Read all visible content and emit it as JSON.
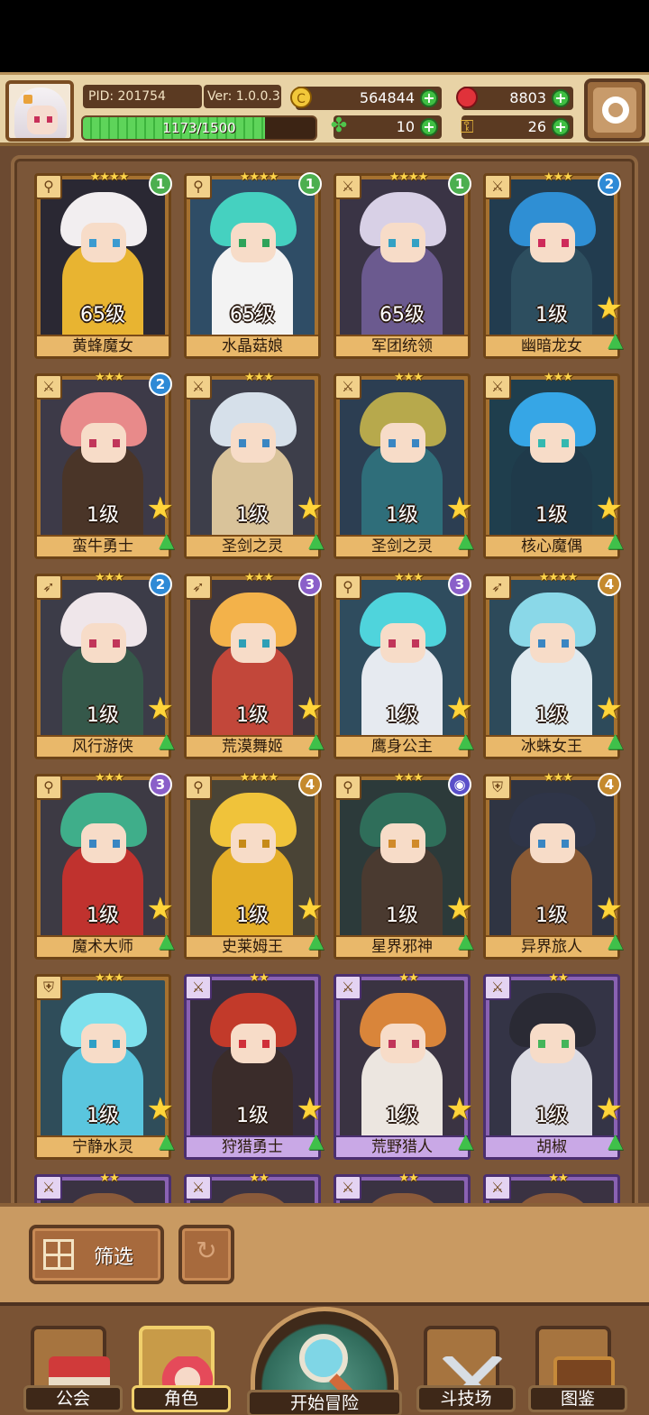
{
  "header": {
    "pid": "PID: 201754",
    "version": "Ver: 1.0.0.3",
    "exp": {
      "text": "1173/1500",
      "current": 1173,
      "max": 1500
    },
    "resources": [
      {
        "name": "gold",
        "icon": "coin-icon",
        "value": "564844",
        "color": "#f2c83a"
      },
      {
        "name": "gems",
        "icon": "red-gem-icon",
        "value": "8803",
        "color": "#e0323a"
      },
      {
        "name": "clover",
        "icon": "clover-icon",
        "value": "10",
        "color": "#4fc54c"
      },
      {
        "name": "key",
        "icon": "key-icon",
        "value": "26",
        "color": "#e4b43a"
      }
    ]
  },
  "cards": [
    {
      "name": "黄蜂魔女",
      "level": "65级",
      "stars": "★★★★",
      "rank": "1",
      "rankColor": "#4caf50",
      "frame": "gold",
      "class": "wand",
      "hair": "#f2eef0",
      "outfit": "#e8b431",
      "bg": "#2a2833",
      "eye": "#3c9bd0",
      "upgrade": false
    },
    {
      "name": "水晶菇娘",
      "level": "65级",
      "stars": "★★★★",
      "rank": "1",
      "rankColor": "#4caf50",
      "frame": "gold",
      "class": "wand",
      "hair": "#45d1c0",
      "outfit": "#f3f3f3",
      "bg": "#2f4d66",
      "eye": "#2fa35a",
      "upgrade": false
    },
    {
      "name": "军团统领",
      "level": "65级",
      "stars": "★★★★",
      "rank": "1",
      "rankColor": "#4caf50",
      "frame": "gold",
      "class": "sword",
      "hair": "#d8d0e6",
      "outfit": "#6b5a8f",
      "bg": "#3a3445",
      "eye": "#34a1c4",
      "upgrade": false
    },
    {
      "name": "幽暗龙女",
      "level": "1级",
      "stars": "★★★",
      "rank": "2",
      "rankColor": "#2e8ad6",
      "frame": "gold",
      "class": "sword",
      "hair": "#2f8fd4",
      "outfit": "#2d4e5f",
      "bg": "#223c4f",
      "eye": "#ce2b5a",
      "upgrade": true
    },
    {
      "name": "蛮牛勇士",
      "level": "1级",
      "stars": "★★★",
      "rank": "2",
      "rankColor": "#2e8ad6",
      "frame": "gold",
      "class": "sword",
      "hair": "#e88a8a",
      "outfit": "#4a3528",
      "bg": "#3d3a48",
      "eye": "#c1365a",
      "upgrade": true
    },
    {
      "name": "圣剑之灵",
      "level": "1级",
      "stars": "★★★",
      "rank": "",
      "rankColor": "",
      "frame": "gold",
      "class": "sword",
      "hair": "#d6e0ea",
      "outfit": "#d9c39a",
      "bg": "#3d3e4a",
      "eye": "#3a86c2",
      "upgrade": true
    },
    {
      "name": "圣剑之灵",
      "level": "1级",
      "stars": "★★★",
      "rank": "",
      "rankColor": "",
      "frame": "gold",
      "class": "sword",
      "hair": "#b7a94c",
      "outfit": "#2f6e7a",
      "bg": "#2c3e52",
      "eye": "#3a86c2",
      "upgrade": true
    },
    {
      "name": "核心魔偶",
      "level": "1级",
      "stars": "★★★",
      "rank": "",
      "rankColor": "",
      "frame": "gold",
      "class": "sword",
      "hair": "#36a6e6",
      "outfit": "#1f3a4a",
      "bg": "#1f3e4d",
      "eye": "#35b8b0",
      "upgrade": true
    },
    {
      "name": "风行游侠",
      "level": "1级",
      "stars": "★★★",
      "rank": "2",
      "rankColor": "#2e8ad6",
      "frame": "gold",
      "class": "bow",
      "hair": "#efe6ea",
      "outfit": "#35584a",
      "bg": "#3c3c48",
      "eye": "#c1365a",
      "upgrade": true
    },
    {
      "name": "荒漠舞姬",
      "level": "1级",
      "stars": "★★★",
      "rank": "3",
      "rankColor": "#8a5fc9",
      "frame": "gold",
      "class": "bow",
      "hair": "#f3b24a",
      "outfit": "#c2473a",
      "bg": "#40383e",
      "eye": "#2f9fb6",
      "upgrade": true
    },
    {
      "name": "鹰身公主",
      "level": "1级",
      "stars": "★★★",
      "rank": "3",
      "rankColor": "#8a5fc9",
      "frame": "gold",
      "class": "wand",
      "hair": "#4fd4dc",
      "outfit": "#e6eaf0",
      "bg": "#2f4c5e",
      "eye": "#c1365a",
      "upgrade": true
    },
    {
      "name": "冰蛛女王",
      "level": "1级",
      "stars": "★★★★",
      "rank": "4",
      "rankColor": "#c58a2e",
      "frame": "gold",
      "class": "bow",
      "hair": "#8ad8e8",
      "outfit": "#dfeaf0",
      "bg": "#2d4a5a",
      "eye": "#3a86c2",
      "upgrade": true
    },
    {
      "name": "魔术大师",
      "level": "1级",
      "stars": "★★★",
      "rank": "3",
      "rankColor": "#8a5fc9",
      "frame": "gold",
      "class": "wand",
      "hair": "#3fae8a",
      "outfit": "#c0322e",
      "bg": "#3d3a44",
      "eye": "#3a86c2",
      "upgrade": true
    },
    {
      "name": "史莱姆王",
      "level": "1级",
      "stars": "★★★★",
      "rank": "4",
      "rankColor": "#c58a2e",
      "frame": "gold",
      "class": "wand",
      "hair": "#f0c33a",
      "outfit": "#e4ae28",
      "bg": "#4a4436",
      "eye": "#c68a18",
      "upgrade": true
    },
    {
      "name": "星界邪神",
      "level": "1级",
      "stars": "★★★",
      "rank": "◉",
      "rankColor": "#5a4fc9",
      "frame": "gold",
      "class": "wand",
      "hair": "#2f6e5a",
      "outfit": "#4a3a30",
      "bg": "#2c3a3a",
      "eye": "#d08a2a",
      "upgrade": true
    },
    {
      "name": "异界旅人",
      "level": "1级",
      "stars": "★★★",
      "rank": "4",
      "rankColor": "#c58a2e",
      "frame": "gold",
      "class": "shield",
      "hair": "#2f3548",
      "outfit": "#8a5a34",
      "bg": "#2f3442",
      "eye": "#3a86c2",
      "upgrade": true
    },
    {
      "name": "宁静水灵",
      "level": "1级",
      "stars": "★★★",
      "rank": "",
      "rankColor": "",
      "frame": "gold",
      "class": "shield",
      "hair": "#7ee0ec",
      "outfit": "#5ac6de",
      "bg": "#2f4d5a",
      "eye": "#2f9fc6",
      "upgrade": true
    },
    {
      "name": "狩猎勇士",
      "level": "1级",
      "stars": "★★",
      "rank": "",
      "rankColor": "",
      "frame": "purple",
      "class": "sword",
      "hair": "#c23a2a",
      "outfit": "#3a2c2a",
      "bg": "#362e3e",
      "eye": "#d0303a",
      "upgrade": true
    },
    {
      "name": "荒野猎人",
      "level": "1级",
      "stars": "★★",
      "rank": "",
      "rankColor": "",
      "frame": "purple",
      "class": "sword",
      "hair": "#d9853a",
      "outfit": "#ece6e0",
      "bg": "#3a3342",
      "eye": "#c1365a",
      "upgrade": true
    },
    {
      "name": "胡椒",
      "level": "1级",
      "stars": "★★",
      "rank": "",
      "rankColor": "",
      "frame": "purple",
      "class": "sword",
      "hair": "#2a2a34",
      "outfit": "#dcdce4",
      "bg": "#343446",
      "eye": "#45b55a",
      "upgrade": true
    }
  ],
  "partialRow": [
    {
      "stars": "★★",
      "frame": "purple"
    },
    {
      "stars": "★★",
      "frame": "purple"
    },
    {
      "stars": "★★",
      "frame": "purple"
    },
    {
      "stars": "★★",
      "frame": "purple"
    }
  ],
  "toolbar": {
    "filter_label": "筛选"
  },
  "nav": [
    {
      "label": "公会",
      "icon": "guild-house-icon",
      "active": false
    },
    {
      "label": "角色",
      "icon": "character-icon",
      "active": true
    },
    {
      "label": "开始冒险",
      "icon": "adventure-magnifier-icon",
      "active": false
    },
    {
      "label": "斗技场",
      "icon": "arena-swords-icon",
      "active": false
    },
    {
      "label": "图鉴",
      "icon": "codex-book-icon",
      "active": false
    }
  ]
}
